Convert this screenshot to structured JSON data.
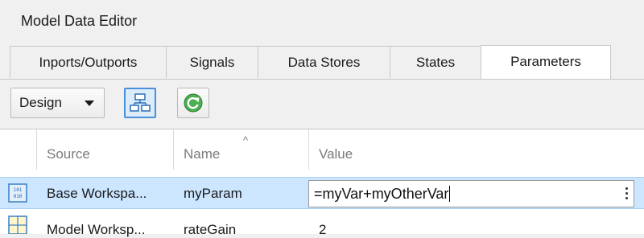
{
  "window": {
    "title": "Model Data Editor"
  },
  "tabs": [
    {
      "label": "Inports/Outports"
    },
    {
      "label": "Signals"
    },
    {
      "label": "Data Stores"
    },
    {
      "label": "States"
    },
    {
      "label": "Parameters"
    }
  ],
  "active_tab": "Parameters",
  "toolbar": {
    "view_dropdown": {
      "selected": "Design"
    },
    "buttons": [
      {
        "icon": "hierarchy-icon",
        "state": "pressed"
      },
      {
        "icon": "refresh-icon",
        "state": "normal"
      }
    ]
  },
  "table": {
    "columns": [
      "Source",
      "Name",
      "Value"
    ],
    "rows": [
      {
        "source_icon": "base-workspace-icon",
        "source": "Base Workspa...",
        "name": "myParam",
        "value": "=myVar+myOtherVar",
        "selected": true,
        "editing": true
      },
      {
        "source_icon": "model-workspace-icon",
        "source": "Model Worksp...",
        "name": "rateGain",
        "value": "2",
        "selected": false,
        "editing": false
      }
    ]
  },
  "colors": {
    "selection": "#cce6ff",
    "accent": "#4a90d9"
  }
}
